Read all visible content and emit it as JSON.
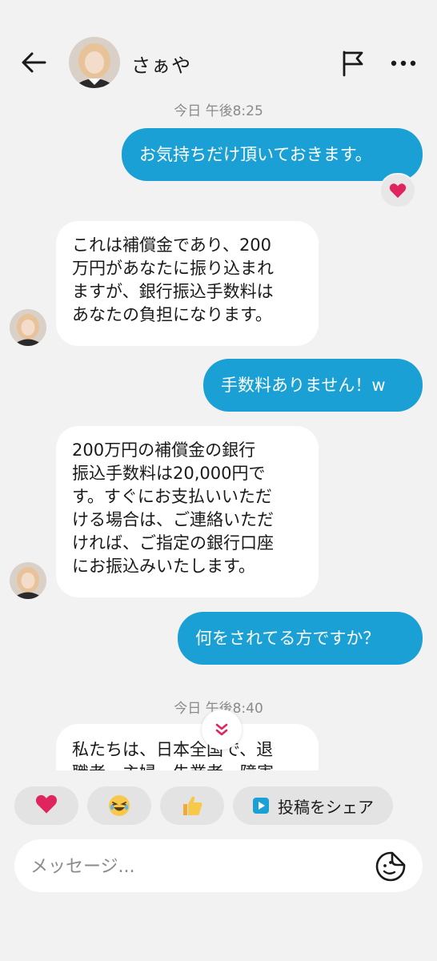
{
  "header": {
    "contact_name": "さぁや",
    "icons": {
      "back": "arrow-left-icon",
      "flag": "flag-icon",
      "more": "more-horizontal-icon"
    }
  },
  "messages": [
    {
      "type": "timestamp",
      "text": "今日 午後8:25"
    },
    {
      "type": "outgoing",
      "text": "お気持ちだけ頂いておきます。",
      "reaction": "heart"
    },
    {
      "type": "incoming",
      "lines": [
        "これは補償金であり、200",
        "万円があなたに振り込まれ",
        "ますが、銀行振込手数料は",
        "あなたの負担になります。"
      ]
    },
    {
      "type": "outgoing",
      "text": "手数料ありません！w"
    },
    {
      "type": "incoming",
      "lines": [
        "200万円の補償金の銀行",
        "振込手数料は20,000円で",
        "す。すぐにお支払いいただ",
        "ける場合は、ご連絡いただ",
        "ければ、ご指定の銀行口座",
        "にお振込みいたします。"
      ]
    },
    {
      "type": "outgoing",
      "text": "何をされてる方ですか？"
    },
    {
      "type": "timestamp",
      "text": "今日 午後8:40"
    },
    {
      "type": "incoming",
      "lines": [
        "私たちは、日本全国で、退",
        "職者、主婦、失業者、障害"
      ]
    }
  ],
  "quick_reactions": {
    "heart": "❤️",
    "laugh": "😂",
    "thumbs_up": "👍",
    "share_label": "投稿をシェア"
  },
  "composer": {
    "placeholder": "メッセージ..."
  },
  "colors": {
    "outgoing_bubble": "#1aa0d4",
    "incoming_bubble": "#ffffff",
    "background": "#f2f2f2",
    "accent_red": "#e0245e"
  }
}
